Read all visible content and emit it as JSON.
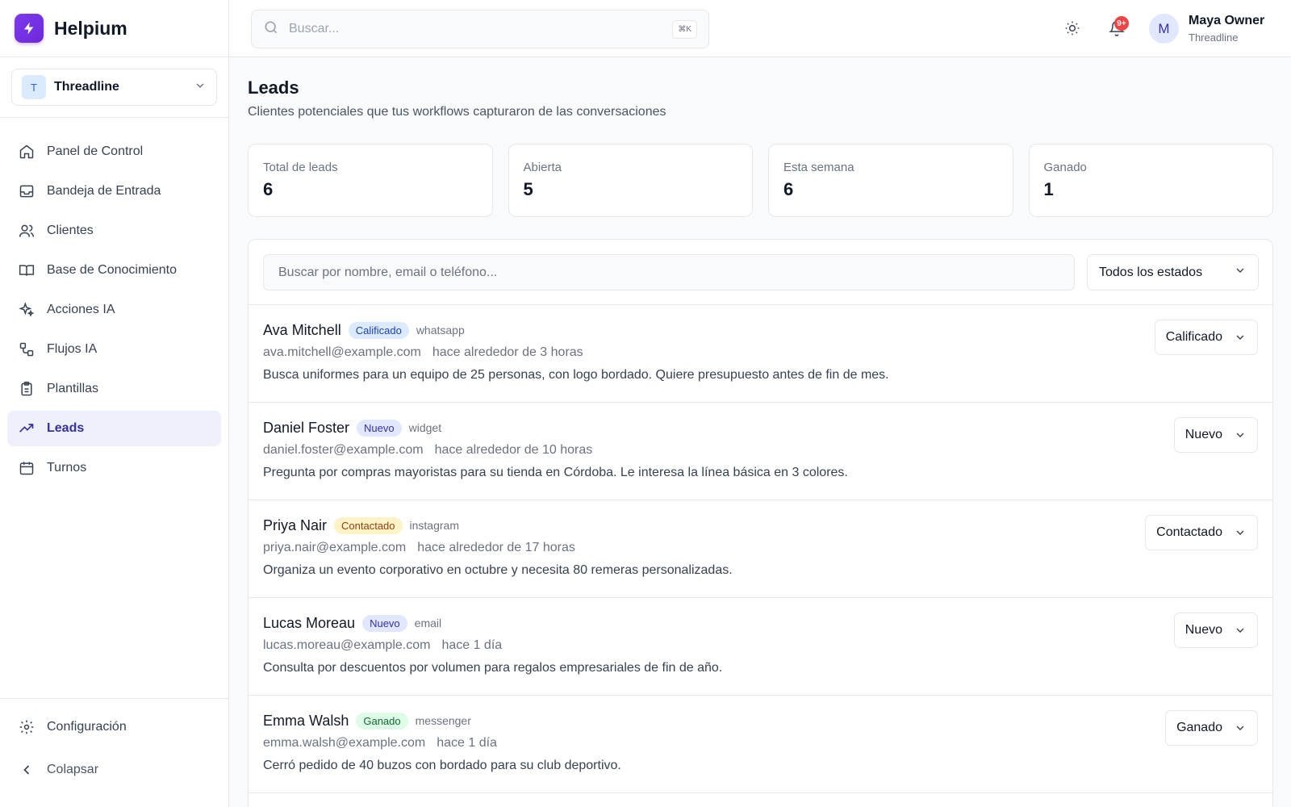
{
  "brand": {
    "name": "Helpium",
    "accent": "#6d28d9"
  },
  "workspace": {
    "initial": "T",
    "name": "Threadline"
  },
  "nav": {
    "items": [
      {
        "label": "Panel de Control",
        "icon": "home-icon"
      },
      {
        "label": "Bandeja de Entrada",
        "icon": "inbox-icon"
      },
      {
        "label": "Clientes",
        "icon": "users-icon"
      },
      {
        "label": "Base de Conocimiento",
        "icon": "book-icon"
      },
      {
        "label": "Acciones IA",
        "icon": "sparkles-icon"
      },
      {
        "label": "Flujos IA",
        "icon": "workflow-icon"
      },
      {
        "label": "Plantillas",
        "icon": "clipboard-icon"
      },
      {
        "label": "Leads",
        "icon": "trending-up-icon",
        "active": true
      },
      {
        "label": "Turnos",
        "icon": "calendar-icon"
      }
    ],
    "settings_label": "Configuración",
    "collapse_label": "Colapsar"
  },
  "header": {
    "search_placeholder": "Buscar...",
    "shortcut": "⌘K",
    "notifications_badge": "9+",
    "user": {
      "initial": "M",
      "name": "Maya Owner",
      "org": "Threadline"
    }
  },
  "page": {
    "title": "Leads",
    "subtitle": "Clientes potenciales que tus workflows capturaron de las conversaciones"
  },
  "stats": [
    {
      "label": "Total de leads",
      "value": "6"
    },
    {
      "label": "Abierta",
      "value": "5"
    },
    {
      "label": "Esta semana",
      "value": "6"
    },
    {
      "label": "Ganado",
      "value": "1"
    }
  ],
  "filters": {
    "search_placeholder": "Buscar por nombre, email o teléfono...",
    "status_selected": "Todos los estados"
  },
  "leads": [
    {
      "name": "Ava Mitchell",
      "status": "Calificado",
      "channel": "whatsapp",
      "email": "ava.mitchell@example.com",
      "time": "hace alrededor de 3 horas",
      "note": "Busca uniformes para un equipo de 25 personas, con logo bordado. Quiere presupuesto antes de fin de mes."
    },
    {
      "name": "Daniel Foster",
      "status": "Nuevo",
      "channel": "widget",
      "email": "daniel.foster@example.com",
      "time": "hace alrededor de 10 horas",
      "note": "Pregunta por compras mayoristas para su tienda en Córdoba. Le interesa la línea básica en 3 colores."
    },
    {
      "name": "Priya Nair",
      "status": "Contactado",
      "channel": "instagram",
      "email": "priya.nair@example.com",
      "time": "hace alrededor de 17 horas",
      "note": "Organiza un evento corporativo en octubre y necesita 80 remeras personalizadas."
    },
    {
      "name": "Lucas Moreau",
      "status": "Nuevo",
      "channel": "email",
      "email": "lucas.moreau@example.com",
      "time": "hace 1 día",
      "note": "Consulta por descuentos por volumen para regalos empresariales de fin de año."
    },
    {
      "name": "Emma Walsh",
      "status": "Ganado",
      "channel": "messenger",
      "email": "emma.walsh@example.com",
      "time": "hace 1 día",
      "note": "Cerró pedido de 40 buzos con bordado para su club deportivo."
    }
  ],
  "status_colors": {
    "Calificado": "#1e40af",
    "Nuevo": "#3730a3",
    "Contactado": "#92400e",
    "Ganado": "#166534"
  }
}
